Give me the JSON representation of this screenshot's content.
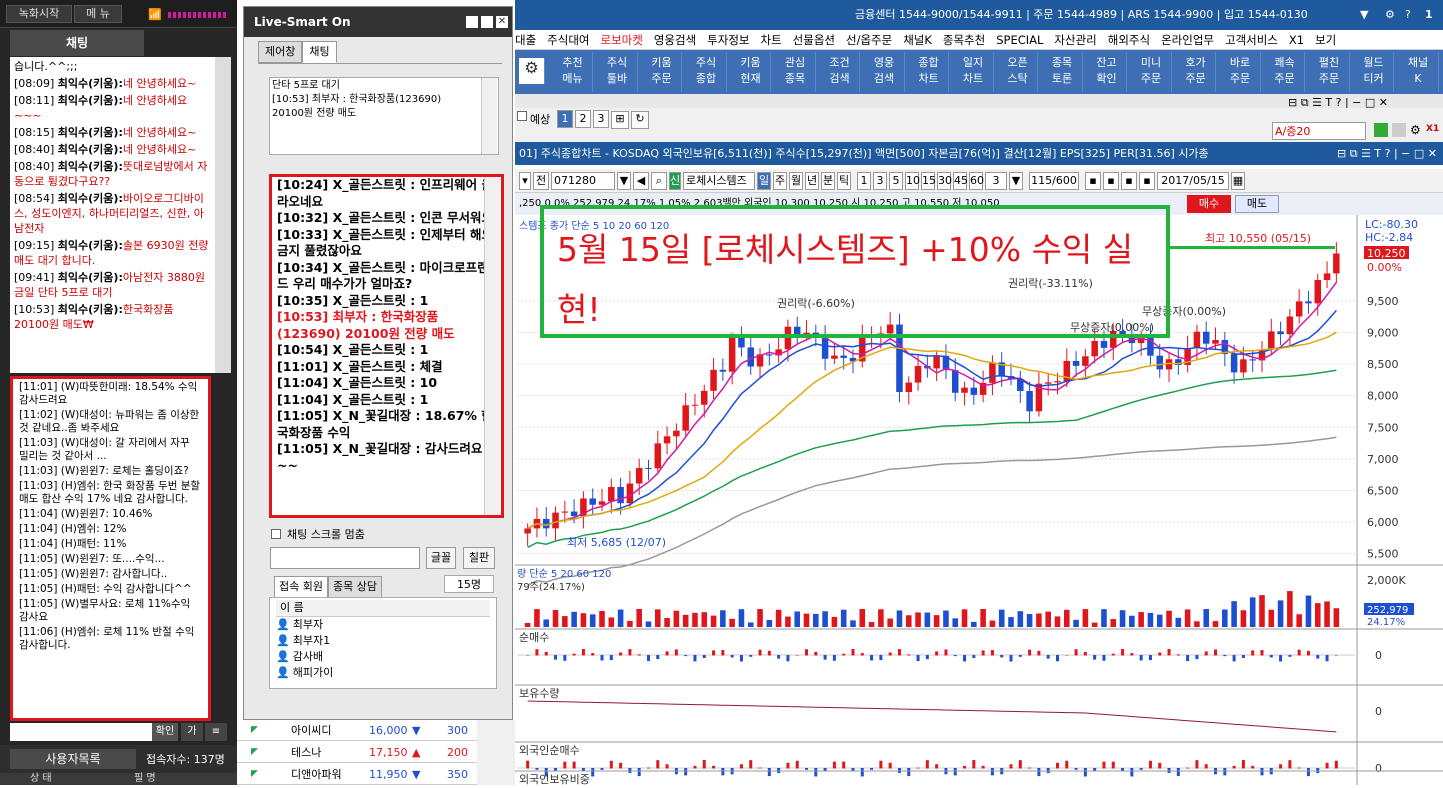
{
  "left_panel": {
    "record_btn": "녹화시작",
    "menu_btn": "메 뉴",
    "chat_tab": "채팅",
    "chat_top": [
      {
        "time": "",
        "name": "",
        "msg": "습니다.^^;;;",
        "msgc": "k"
      },
      {
        "time": "[08:09]",
        "name": "최익수(키움):",
        "msg": "네 안녕하세요~"
      },
      {
        "time": "[08:11]",
        "name": "최익수(키움):",
        "msg": "네 안녕하세요~~~"
      },
      {
        "time": "[08:15]",
        "name": "최익수(키움):",
        "msg": "네 안녕하세요~"
      },
      {
        "time": "[08:40]",
        "name": "최익수(키움):",
        "msg": "네 안녕하세요~"
      },
      {
        "time": "[08:40]",
        "name": "최익수(키움):",
        "msg": "뜻대로넘방에서 자동으로 튕겼다구요??"
      },
      {
        "time": "[08:54]",
        "name": "최익수(키움):",
        "msg": "바이오로그디바이스, 성도이엔지, 하나머티리얼즈, 신한, 아남전자"
      },
      {
        "time": "[09:15]",
        "name": "최익수(키움):",
        "msg": "솔본 6930원 전량 매도 대기 합니다."
      },
      {
        "time": "[09:41]",
        "name": "최익수(키움):",
        "msg": "아남전자 3880원 금일 단타 5프로 대기"
      },
      {
        "time": "[10:53]",
        "name": "최익수(키움):",
        "msg": "한국화장품 20100원 매도₩"
      }
    ],
    "chat_bottom": [
      {
        "t": "[11:01]",
        "n": "(W)따뜻한미래:",
        "m": "18.54% 수익감사드려요"
      },
      {
        "t": "[11:02]",
        "n": "(W)대성이:",
        "m": "뉴파워는 좀 이상한것 같네요..좀 봐주세요"
      },
      {
        "t": "[11:03]",
        "n": "(W)대성이:",
        "m": "갈 자리에서 자꾸 밀리는 것 같아서 ..."
      },
      {
        "t": "[11:03]",
        "n": "(W)윈윈7:",
        "m": "로체는 홀딩이죠?"
      },
      {
        "t": "[11:03]",
        "n": "(H)엠쉬:",
        "m": "한국 화장품 두번 분할 매도 합산 수익 17% 네요 감사합니다."
      },
      {
        "t": "[11:04]",
        "n": "(W)윈윈7:",
        "m": "10.46%"
      },
      {
        "t": "[11:04]",
        "n": "(H)엠쉬:",
        "m": "12%"
      },
      {
        "t": "[11:04]",
        "n": "(H)패턴:",
        "m": "11%"
      },
      {
        "t": "[11:05]",
        "n": "(W)윈윈7:",
        "m": "또....수익..."
      },
      {
        "t": "[11:05]",
        "n": "(W)윈윈7:",
        "m": "감사합니다.."
      },
      {
        "t": "[11:05]",
        "n": "(H)패턴:",
        "m": "수익 감사합니다^^"
      },
      {
        "t": "[11:05]",
        "n": "(W)별무사요:",
        "m": "로체 11%수익 감사요"
      },
      {
        "t": "[11:06]",
        "n": "(H)엠쉬:",
        "m": "로체 11% 반절 수익 감사합니다."
      }
    ],
    "confirm_btn": "확인",
    "user_list": "사용자목록",
    "connected": "접속자수: 137명",
    "col_status": "상 태",
    "col_name": "필 명"
  },
  "live": {
    "title": "Live-Smart On",
    "tab1": "제어창",
    "tab2": "채팅",
    "notice": [
      "단타 5프로 대기",
      "[10:53] 최부자 : 한국화장품(123690)",
      "20100원 전량 매도"
    ],
    "chat": [
      {
        "text": "[10:24] X_골든스트릿 : 인프리웨어 올라오네요",
        "red": false
      },
      {
        "text": "[10:32] X_골든스트릿 : 인콘 무서워요",
        "red": false
      },
      {
        "text": "[10:33] X_골든스트릿 : 인제부터 해요 금지 풀렸잖아요",
        "red": false
      },
      {
        "text": "[10:34] X_골든스트릿 : 마이크로프랜드 우리 매수가가 얼마죠?",
        "red": false
      },
      {
        "text": "[10:35] X_골든스트릿 : 1",
        "red": false
      },
      {
        "text": "[10:53] 최부자 : 한국화장품(123690) 20100원 전량 매도",
        "red": true
      },
      {
        "text": "[10:54] X_골든스트릿 : 1",
        "red": false
      },
      {
        "text": "[11:01] X_골든스트릿 : 체결",
        "red": false
      },
      {
        "text": "[11:04] X_골든스트릿 : 10",
        "red": false
      },
      {
        "text": "[11:04] X_골든스트릿 : 1",
        "red": false
      },
      {
        "text": "[11:05] X_N_꽃길대장 : 18.67% 한국화장품 수익",
        "red": false
      },
      {
        "text": "[11:05] X_N_꽃길대장 : 감사드려요~~",
        "red": false
      }
    ],
    "scroll_stop": "채팅 스크롤 멈춤",
    "font_btn": "글꼴",
    "board_btn": "칠판",
    "members_tab": "접속 회원",
    "consult_tab": "종목 상담",
    "count": "15명",
    "list_header": "이 름",
    "members": [
      "최부자",
      "최부자1",
      "감사배",
      "해피가이"
    ]
  },
  "app": {
    "topbar": "금융센터 1544-9000/1544-9911 | 주문 1544-4989 | ARS 1544-9900 | 입고 1544-0130",
    "menus": [
      "대출",
      "주식대여",
      "로보마켓",
      "영웅검색",
      "투자정보",
      "차트",
      "선물옵션",
      "선/옵주문",
      "채널K",
      "종목추천",
      "SPECIAL",
      "자산관리",
      "해외주식",
      "온라인업무",
      "고객서비스",
      "X1",
      "보기"
    ],
    "menu_highlight": "로보마켓",
    "toolbar": [
      [
        "추천",
        "메뉴"
      ],
      [
        "주식",
        "툴바"
      ],
      [
        "키움",
        "주문"
      ],
      [
        "주식",
        "종합"
      ],
      [
        "키움",
        "현재"
      ],
      [
        "관심",
        "종목"
      ],
      [
        "조건",
        "검색"
      ],
      [
        "영웅",
        "검색"
      ],
      [
        "종합",
        "차트"
      ],
      [
        "일지",
        "차트"
      ],
      [
        "오픈",
        "스탁"
      ],
      [
        "종목",
        "토론"
      ],
      [
        "잔고",
        "확인"
      ],
      [
        "미니",
        "주문"
      ],
      [
        "호가",
        "주문"
      ],
      [
        "바로",
        "주문"
      ],
      [
        "쾌속",
        "주문"
      ],
      [
        "펼친",
        "주문"
      ],
      [
        "월드",
        "티커"
      ],
      [
        "채널",
        "K"
      ]
    ],
    "preview": "예상",
    "pages": [
      "1",
      "2",
      "3"
    ],
    "chart_title": "01] 주식종합차트 - KOSDAQ 외국인보유[6,511(천)] 주식수[15,297(천)] 액면[500] 자본금[76(억)] 결산[12월] EPS[325] PER[31.56] 시가총",
    "code": "071280",
    "stock_name": "로체시스템즈",
    "periods": [
      "일",
      "주",
      "월",
      "년",
      "분",
      "틱"
    ],
    "minutes": [
      "1",
      "3",
      "5",
      "10",
      "15",
      "30",
      "45",
      "60"
    ],
    "count_sel": "3",
    "range": "115/600",
    "date": "2017/05/15",
    "price_row": ",250   0   0%   252,979   24.17%   1.05%   2,603백만   외국인   10,300   10,250   시 10,250   고 10,550   저 10,050",
    "buy_btn": "매수",
    "sell_btn": "매도",
    "right_label": "A/증20"
  },
  "chart_data": {
    "type": "candlestick",
    "title": "5월 15일 [로체시스템즈] +10% 수익 실현!",
    "ma_label": "스템즈  종가 단순 5 10 20 60 120",
    "lc_label": "LC:-80.30",
    "hc_label": "HC:-2.84",
    "high_label": "최고 10,550 (05/15)",
    "low_label": "최저 5,685 (12/07)",
    "cur_price": "10,250",
    "cur_pct": "0.00%",
    "annotations": [
      "권리락(-6.60%)",
      "권리락(-33.11%)",
      "무상증자(0.00%)",
      "무상증자(0.00%)"
    ],
    "y_ticks": [
      "9,500",
      "9,000",
      "8,500",
      "8,000",
      "7,500",
      "7,000",
      "6,500",
      "6,000",
      "5,500"
    ],
    "ylim": [
      5400,
      10700
    ],
    "volume_label": "량 단순 5 20 60 120",
    "volume_sub": "79주(24.17%)",
    "vol_ticks": [
      "2,000K",
      "1,000K"
    ],
    "vol_cur": "252,979",
    "vol_pct": "24.17%",
    "panels": [
      {
        "label": "순매수",
        "tick": "0"
      },
      {
        "label": "보유수량",
        "tick": "0"
      },
      {
        "label": "외국인순매수",
        "tick": "0"
      },
      {
        "label": "외국인보유비중",
        "tick": ""
      }
    ]
  },
  "rank": [
    {
      "name": "아이씨디",
      "price": "16,000",
      "dir": "▼",
      "chg": "300",
      "color": "#1f4fd1"
    },
    {
      "name": "테스나",
      "price": "17,150",
      "dir": "▲",
      "chg": "200",
      "color": "#e0161d"
    },
    {
      "name": "디앤아파워",
      "price": "11,950",
      "dir": "▼",
      "chg": "350",
      "color": "#1f4fd1"
    }
  ]
}
